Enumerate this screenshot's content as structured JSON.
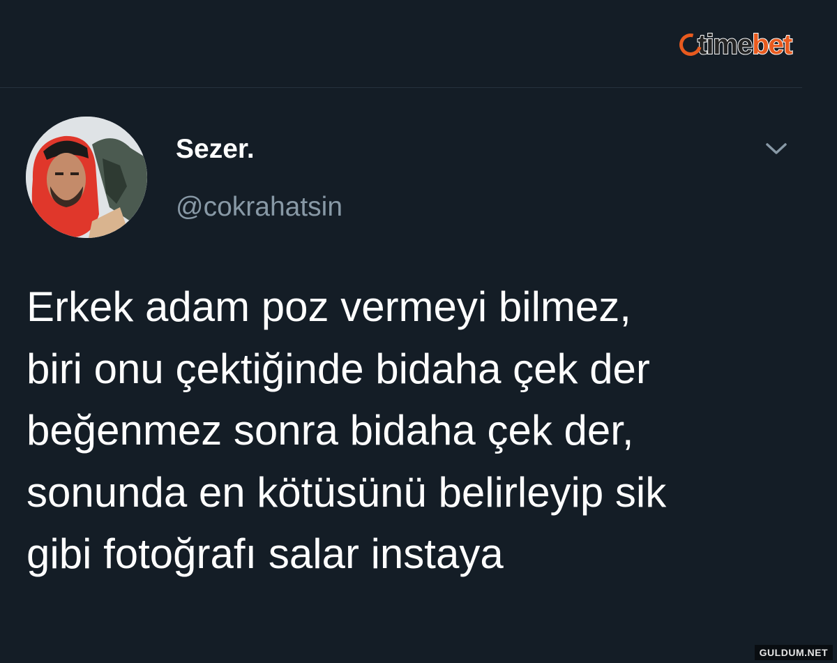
{
  "logo": {
    "part1": "time",
    "part2": "bet",
    "icon": "clock-logo-icon",
    "brand_color": "#e85a1e"
  },
  "tweet": {
    "display_name": "Sezer.",
    "handle": "@cokrahatsin",
    "text_lines": [
      "Erkek adam poz vermeyi bilmez,",
      "biri onu çektiğinde bidaha çek der",
      "beğenmez sonra bidaha çek der,",
      "sonunda en kötüsünü belirleyip sik",
      "gibi fotoğrafı salar instaya"
    ],
    "menu_icon": "chevron-down-icon"
  },
  "watermark": "GULDUM.NET",
  "colors": {
    "background": "#141d26",
    "secondary_text": "#8899a6",
    "primary_text": "#ffffff"
  }
}
